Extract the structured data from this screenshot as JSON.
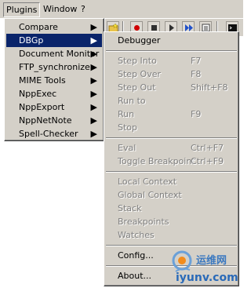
{
  "menubar": {
    "items": [
      {
        "label": "Plugins",
        "open": true
      },
      {
        "label": "Window"
      },
      {
        "label": "?"
      }
    ]
  },
  "toolbar": {
    "icons": [
      "folder-star-icon",
      "record-icon",
      "stop-icon",
      "play-icon",
      "fast-forward-icon",
      "macro-list-icon",
      "console-icon"
    ]
  },
  "plugins_menu": {
    "items": [
      {
        "label": "Compare",
        "has_submenu": true
      },
      {
        "label": "DBGp",
        "has_submenu": true,
        "selected": true
      },
      {
        "label": "Document Monitor",
        "has_submenu": true
      },
      {
        "label": "FTP_synchronize",
        "has_submenu": true
      },
      {
        "label": "MIME Tools",
        "has_submenu": true
      },
      {
        "label": "NppExec",
        "has_submenu": true
      },
      {
        "label": "NppExport",
        "has_submenu": true
      },
      {
        "label": "NppNetNote",
        "has_submenu": true
      },
      {
        "label": "Spell-Checker",
        "has_submenu": true
      }
    ],
    "arrow": "▶"
  },
  "dbgp_menu": {
    "debugger": "Debugger",
    "step_into": {
      "label": "Step Into",
      "key": "F7"
    },
    "step_over": {
      "label": "Step Over",
      "key": "F8"
    },
    "step_out": {
      "label": "Step Out",
      "key": "Shift+F8"
    },
    "run_to": {
      "label": "Run to"
    },
    "run": {
      "label": "Run",
      "key": "F9"
    },
    "stop": {
      "label": "Stop"
    },
    "eval": {
      "label": "Eval",
      "key": "Ctrl+F7"
    },
    "toggle_breakpoint": {
      "label": "Toggle Breakpoint",
      "key": "Ctrl+F9"
    },
    "local_context": "Local Context",
    "global_context": "Global Context",
    "stack": "Stack",
    "breakpoints": "Breakpoints",
    "watches": "Watches",
    "config": "Config...",
    "about": "About..."
  },
  "watermark": {
    "cn_text": "运维网",
    "url": "iyunv.com"
  },
  "colors": {
    "menu_bg": "#d4d0c8",
    "highlight": "#0a246a",
    "disabled": "#808080"
  }
}
